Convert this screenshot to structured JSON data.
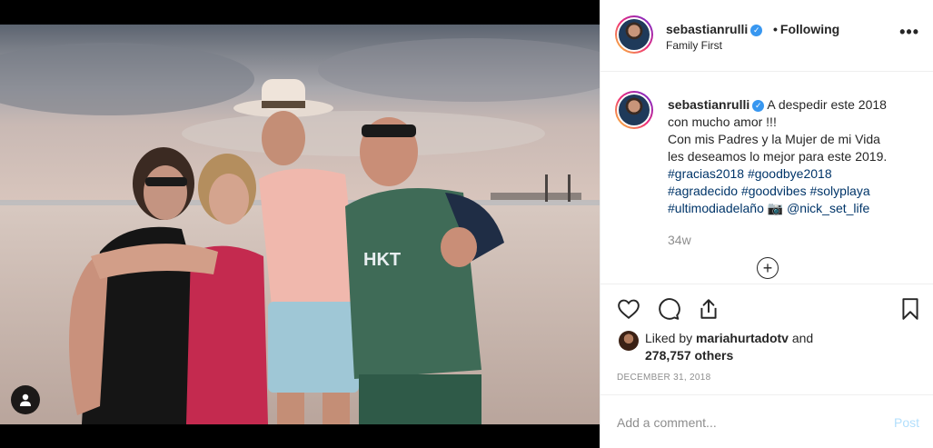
{
  "post": {
    "username": "sebastianrulli",
    "verified_mark": "✓",
    "follow_separator": "•",
    "follow_status": "Following",
    "location": "Family First",
    "more_label": "•••",
    "photo_icon": "person-tag-icon"
  },
  "caption": {
    "username": "sebastianrulli",
    "line1": "A despedir este 2018",
    "line2": "con mucho amor !!!",
    "line3": "Con mis Padres y la Mujer de mi Vida",
    "line4": "les deseamos lo mejor para este 2019.",
    "hashtags_line1": [
      "#gracias2018",
      "#goodbye2018"
    ],
    "hashtags_line2": [
      "#agradecido",
      "#goodvibes",
      "#solyplaya"
    ],
    "hashtags_line3_tag": "#ultimodiadelaño",
    "camera_emoji": "📷",
    "mention": "@nick_set_life",
    "time_ago": "34w",
    "load_more_label": "+"
  },
  "actions": {
    "like_icon": "heart-icon",
    "comment_icon": "comment-icon",
    "share_icon": "share-icon",
    "save_icon": "bookmark-icon"
  },
  "likes": {
    "prefix": "Liked by ",
    "liker": "mariahurtadotv",
    "and": " and",
    "count": "278,757 others"
  },
  "date": "DECEMBER 31, 2018",
  "comment": {
    "placeholder": "Add a comment...",
    "post_label": "Post"
  },
  "colors": {
    "link": "#003569",
    "verified": "#3897f0",
    "post_disabled": "#b2dffc",
    "muted": "#8e8e8e"
  }
}
